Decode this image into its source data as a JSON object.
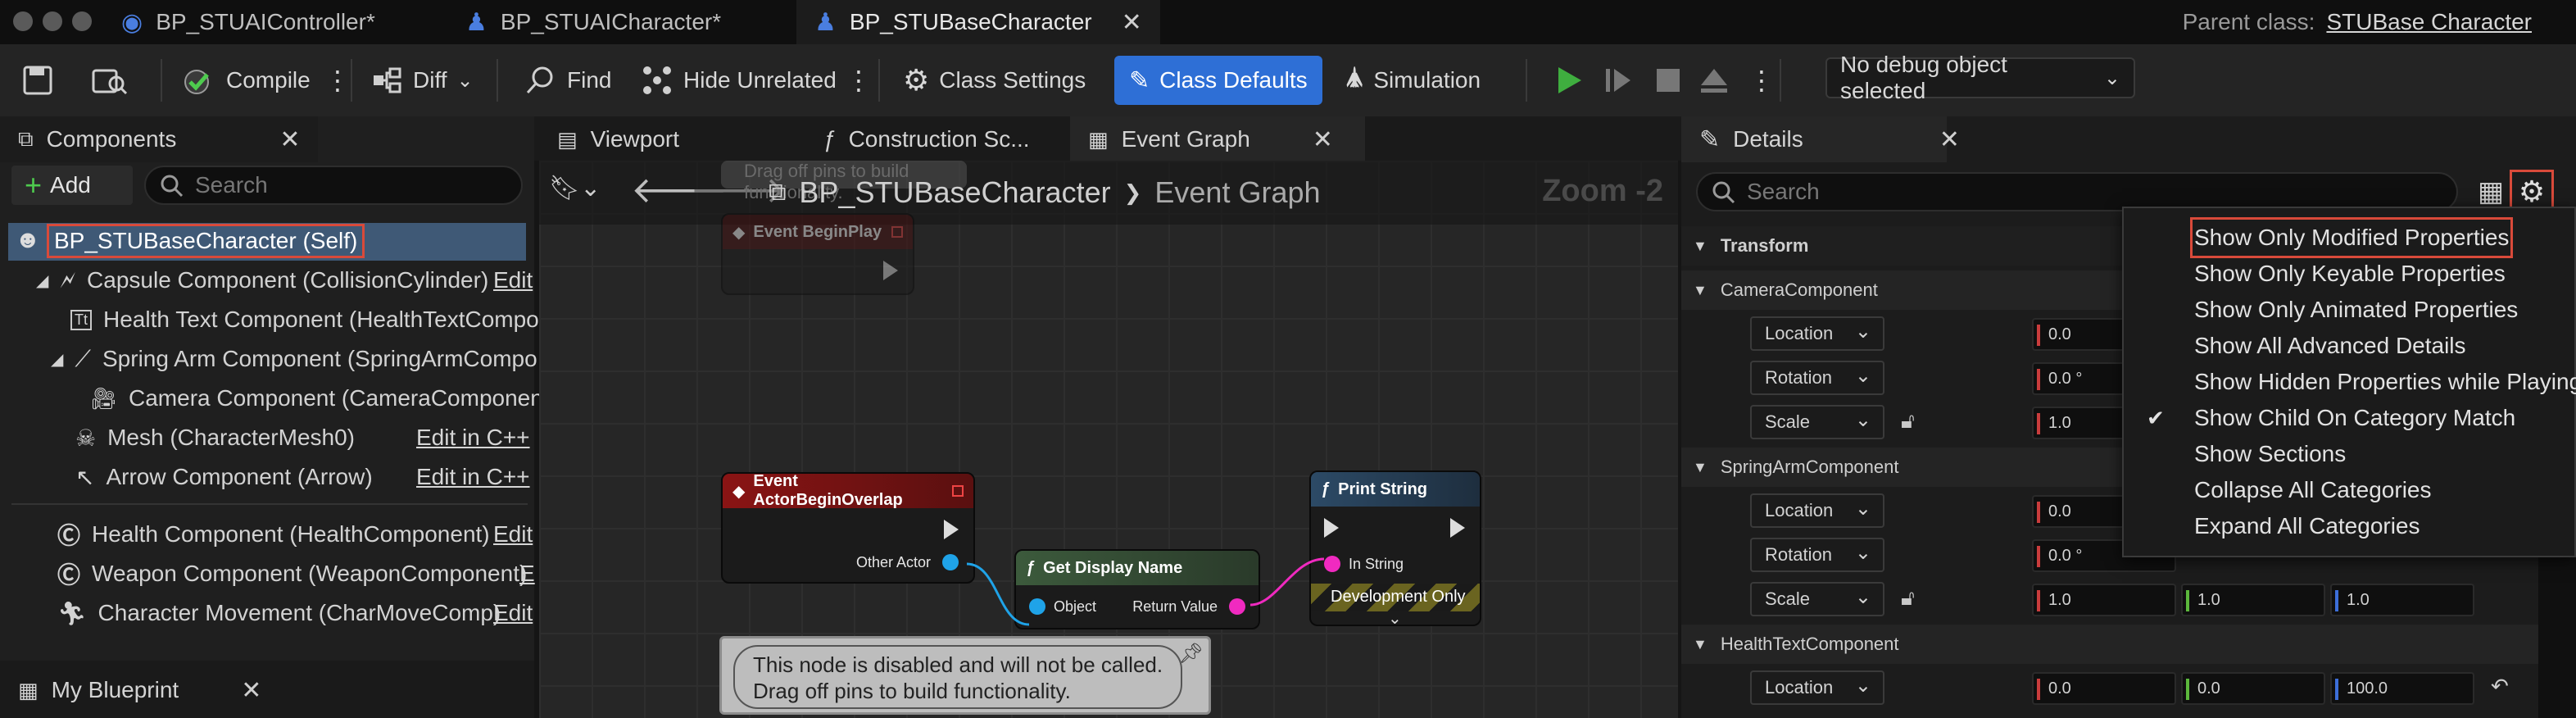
{
  "titlebar": {
    "tabs": [
      {
        "label": "BP_STUAIController*"
      },
      {
        "label": "BP_STUAICharacter*"
      },
      {
        "label": "BP_STUBaseCharacter"
      }
    ],
    "close": "✕",
    "parent_label": "Parent class:",
    "parent_value": "STUBase Character"
  },
  "toolbar": {
    "compile": "Compile",
    "diff": "Diff",
    "find": "Find",
    "hide_unrelated": "Hide Unrelated",
    "class_settings": "Class Settings",
    "class_defaults": "Class Defaults",
    "simulation": "Simulation",
    "debug_object": "No debug object selected"
  },
  "components": {
    "title": "Components",
    "add": "Add",
    "search_placeholder": "Search",
    "root": "BP_STUBaseCharacter (Self)",
    "items": [
      {
        "label": "Capsule Component (CollisionCylinder)",
        "edit": "Edit"
      },
      {
        "label": "Health Text Component (HealthTextCompo",
        "edit": ""
      },
      {
        "label": "Spring Arm Component (SpringArmCompo",
        "edit": ""
      },
      {
        "label": "Camera Component (CameraComponent",
        "edit": ""
      },
      {
        "label": "Mesh (CharacterMesh0)",
        "edit": "Edit in C++"
      },
      {
        "label": "Arrow Component (Arrow)",
        "edit": "Edit in C++"
      },
      {
        "label": "Health Component (HealthComponent)",
        "edit": "Edit"
      },
      {
        "label": "Weapon Component (WeaponComponent)",
        "edit": "E"
      },
      {
        "label": "Character Movement (CharMoveComp)",
        "edit": "Edit"
      }
    ]
  },
  "my_blueprint": {
    "title": "My Blueprint"
  },
  "graph": {
    "tabs": [
      {
        "label": "Viewport"
      },
      {
        "label": "Construction Sc..."
      },
      {
        "label": "Event Graph"
      }
    ],
    "breadcrumb_root": "BP_STUBaseCharacter",
    "breadcrumb_sep": "❯",
    "breadcrumb_leaf": "Event Graph",
    "zoom": "Zoom -2",
    "top_note": "Drag off pins to build functionality.",
    "nodes": {
      "begin_play": "Event BeginPlay",
      "begin_overlap": "Event ActorBeginOverlap",
      "other_actor": "Other Actor",
      "get_display_name": "Get Display Name",
      "object": "Object",
      "return_value": "Return Value",
      "print_string": "Print String",
      "in_string": "In String",
      "dev_only": "Development Only"
    },
    "disabled_note_line1": "This node is disabled and will not be called.",
    "disabled_note_line2": "Drag off pins to build functionality."
  },
  "details": {
    "title": "Details",
    "search_placeholder": "Search",
    "categories": {
      "transform": "Transform",
      "camera": "CameraComponent",
      "spring_arm": "SpringArmComponent",
      "health_text": "HealthTextComponent"
    },
    "labels": {
      "location": "Location",
      "rotation": "Rotation",
      "scale": "Scale"
    },
    "values": {
      "cam_loc": "0.0",
      "cam_rot": "0.0 °",
      "cam_scale": "1.0",
      "sa_loc": "0.0",
      "sa_rot": "0.0 °",
      "sa_scale_x": "1.0",
      "sa_scale_y": "1.0",
      "sa_scale_z": "1.0",
      "ht_loc_x": "0.0",
      "ht_loc_y": "0.0",
      "ht_loc_z": "100.0"
    }
  },
  "settings_menu": {
    "items": [
      {
        "label": "Show Only Modified Properties",
        "checked": false
      },
      {
        "label": "Show Only Keyable Properties",
        "checked": false
      },
      {
        "label": "Show Only Animated Properties",
        "checked": false
      },
      {
        "label": "Show All Advanced Details",
        "checked": false
      },
      {
        "label": "Show Hidden Properties while Playing",
        "checked": false
      },
      {
        "label": "Show Child On Category Match",
        "checked": true
      },
      {
        "label": "Show Sections",
        "checked": false
      },
      {
        "label": "Collapse All Categories",
        "checked": false
      },
      {
        "label": "Expand All Categories",
        "checked": false
      }
    ],
    "check_glyph": "✔"
  },
  "colors": {
    "accent": "#2e6fd6",
    "highlight": "#d94a3a",
    "event_header": "#8a1414",
    "pure_header": "#3c5a3c",
    "function_header": "#2c4a66"
  }
}
